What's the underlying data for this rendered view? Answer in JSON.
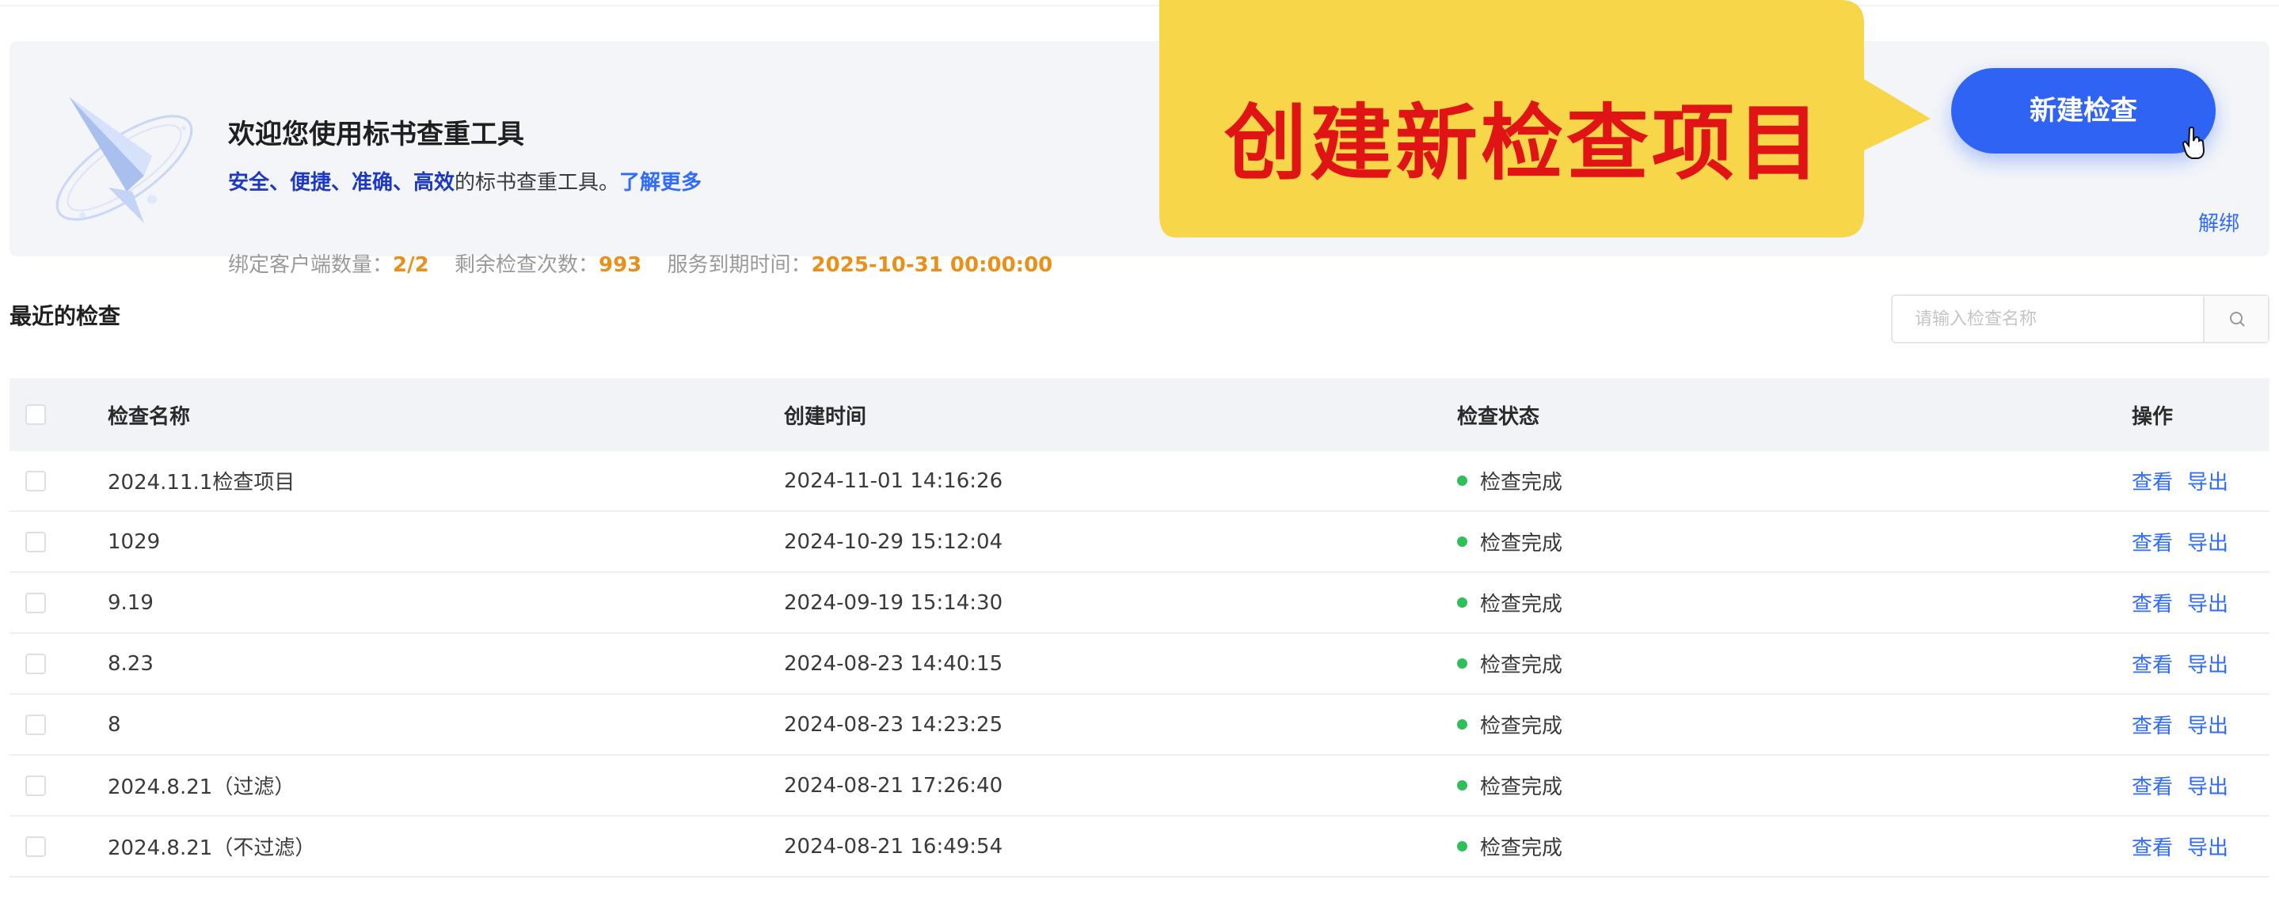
{
  "banner": {
    "title": "欢迎您使用标书查重工具",
    "subtitle_highlight": "安全、便捷、准确、高效",
    "subtitle_rest": "的标书查重工具。",
    "learn_more": "了解更多",
    "stats": [
      {
        "label": "绑定客户端数量：",
        "value": "2/2"
      },
      {
        "label": "剩余检查次数：",
        "value": "993"
      },
      {
        "label": "服务到期时间：",
        "value": "2025-10-31 00:00:00"
      }
    ],
    "callout_text": "创建新检查项目",
    "new_button": "新建检查",
    "unbind": "解绑"
  },
  "recent": {
    "title": "最近的检查",
    "search_placeholder": "请输入检查名称"
  },
  "table": {
    "columns": [
      "检查名称",
      "创建时间",
      "检查状态",
      "操作"
    ],
    "rows": [
      {
        "name": "2024.11.1检查项目",
        "time": "2024-11-01 14:16:26",
        "status": "检查完成"
      },
      {
        "name": "1029",
        "time": "2024-10-29 15:12:04",
        "status": "检查完成"
      },
      {
        "name": "9.19",
        "time": "2024-09-19 15:14:30",
        "status": "检查完成"
      },
      {
        "name": "8.23",
        "time": "2024-08-23 14:40:15",
        "status": "检查完成"
      },
      {
        "name": "8",
        "time": "2024-08-23 14:23:25",
        "status": "检查完成"
      },
      {
        "name": "2024.8.21（过滤）",
        "time": "2024-08-21 17:26:40",
        "status": "检查完成"
      },
      {
        "name": "2024.8.21（不过滤）",
        "time": "2024-08-21 16:49:54",
        "status": "检查完成"
      }
    ],
    "op_view": "查看",
    "op_export": "导出"
  },
  "colors": {
    "primary": "#2f63f4",
    "link": "#2f6bff",
    "accent_orange": "#e8901a",
    "callout_yellow": "#f7d64a",
    "callout_text": "#e01414",
    "status_green": "#2fbf5a"
  },
  "icons": [
    "rocket-illustration",
    "search-icon",
    "cursor-hand-icon"
  ]
}
